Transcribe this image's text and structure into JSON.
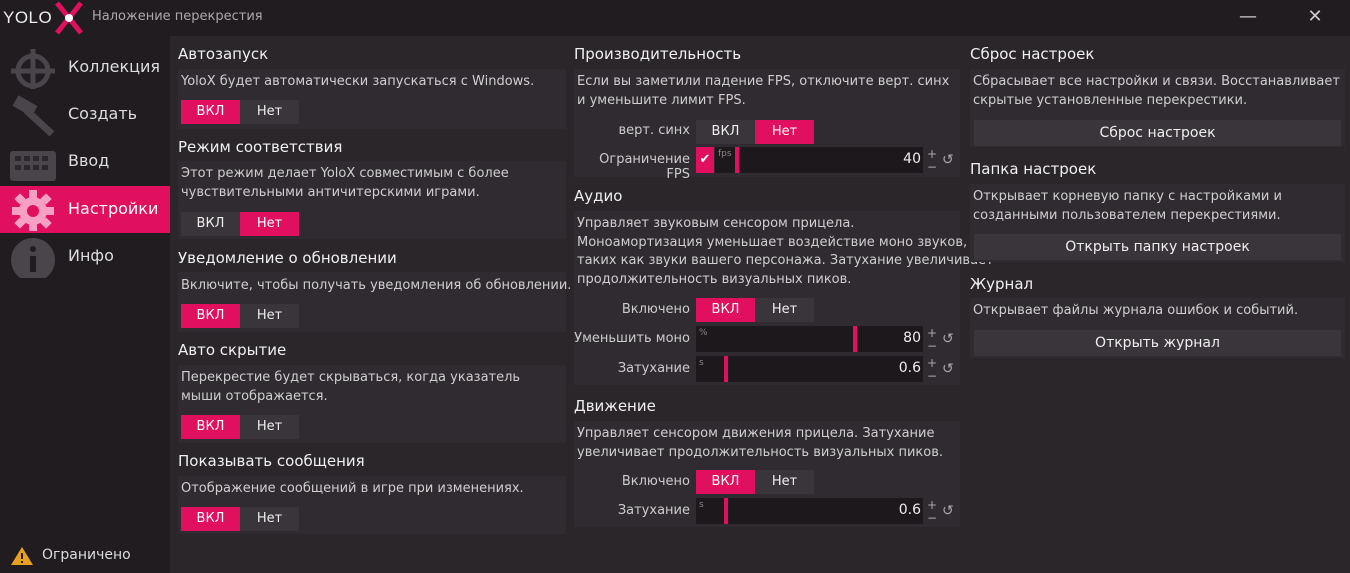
{
  "app": {
    "logo": "YOLO",
    "title": "Наложение перекрестия",
    "minimize": "—",
    "close": "✕"
  },
  "sidebar": {
    "items": [
      {
        "label": "Коллекция",
        "icon": "crosshair-icon"
      },
      {
        "label": "Создать",
        "icon": "hammer-icon"
      },
      {
        "label": "Ввод",
        "icon": "keyboard-icon"
      },
      {
        "label": "Настройки",
        "icon": "gear-icon",
        "active": true
      },
      {
        "label": "Инфо",
        "icon": "info-icon"
      }
    ],
    "status": "Ограничено"
  },
  "accent": "#e0105e",
  "left": {
    "autostart": {
      "title": "Автозапуск",
      "desc": "YoloX будет автоматически запускаться с Windows.",
      "on": "ВКЛ",
      "off": "Нет",
      "value": "on"
    },
    "compat": {
      "title": "Режим соответствия",
      "desc1": "Этот режим делает YoloX совместимым с более",
      "desc2": "чувствительными античитерскими играми.",
      "on": "ВКЛ",
      "off": "Нет",
      "value": "off"
    },
    "update": {
      "title": "Уведомление о обновлении",
      "desc": "Включите, чтобы получать уведомления об обновлении.",
      "on": "ВКЛ",
      "off": "Нет",
      "value": "on"
    },
    "autohide": {
      "title": "Авто скрытие",
      "desc1": "Перекрестие будет скрываться, когда указатель",
      "desc2": "мыши отображается.",
      "on": "ВКЛ",
      "off": "Нет",
      "value": "on"
    },
    "messages": {
      "title": "Показывать сообщения",
      "desc": "Отображение сообщений в игре при изменениях.",
      "on": "ВКЛ",
      "off": "Нет",
      "value": "on"
    }
  },
  "middle": {
    "perf": {
      "title": "Производительность",
      "desc1": "Если вы заметили падение FPS, отключите верт. синх",
      "desc2": "и уменьшите лимит FPS.",
      "vsync_label": "верт. синх",
      "on": "ВКЛ",
      "off": "Нет",
      "vsync_value": "off",
      "fps_label": "Ограничение FPS",
      "fps_unit": "fps",
      "fps_value": "40",
      "fps_checked": "✔"
    },
    "audio": {
      "title": "Аудио",
      "desc1": "Управляет звуковым сенсором прицела.",
      "desc2": "Моноамортизация уменьшает воздействие моно звуков,",
      "desc3": "таких как звуки вашего персонажа. Затухание увеличивает",
      "desc4": "продолжительность визуальных пиков.",
      "enabled_label": "Включено",
      "on": "ВКЛ",
      "off": "Нет",
      "enabled_value": "on",
      "mono_label": "Уменьшить моно",
      "mono_unit": "%",
      "mono_value": "80",
      "fade_label": "Затухание",
      "fade_unit": "s",
      "fade_value": "0.6"
    },
    "motion": {
      "title": "Движение",
      "desc1": "Управляет сенсором движения прицела. Затухание",
      "desc2": "увеличивает продолжительность визуальных пиков.",
      "enabled_label": "Включено",
      "on": "ВКЛ",
      "off": "Нет",
      "enabled_value": "on",
      "fade_label": "Затухание",
      "fade_unit": "s",
      "fade_value": "0.6"
    }
  },
  "right": {
    "reset": {
      "title": "Сброс настроек",
      "desc1": "Сбрасывает все настройки и связи. Восстанавливает",
      "desc2": "скрытые установленные перекрестики.",
      "button": "Сброс настроек"
    },
    "folder": {
      "title": "Папка настроек",
      "desc1": "Открывает корневую папку с настройками и",
      "desc2": "созданными пользователем перекрестиями.",
      "button": "Открыть папку настроек"
    },
    "log": {
      "title": "Журнал",
      "desc": "Открывает файлы журнала ошибок и событий.",
      "button": "Открыть журнал"
    }
  }
}
